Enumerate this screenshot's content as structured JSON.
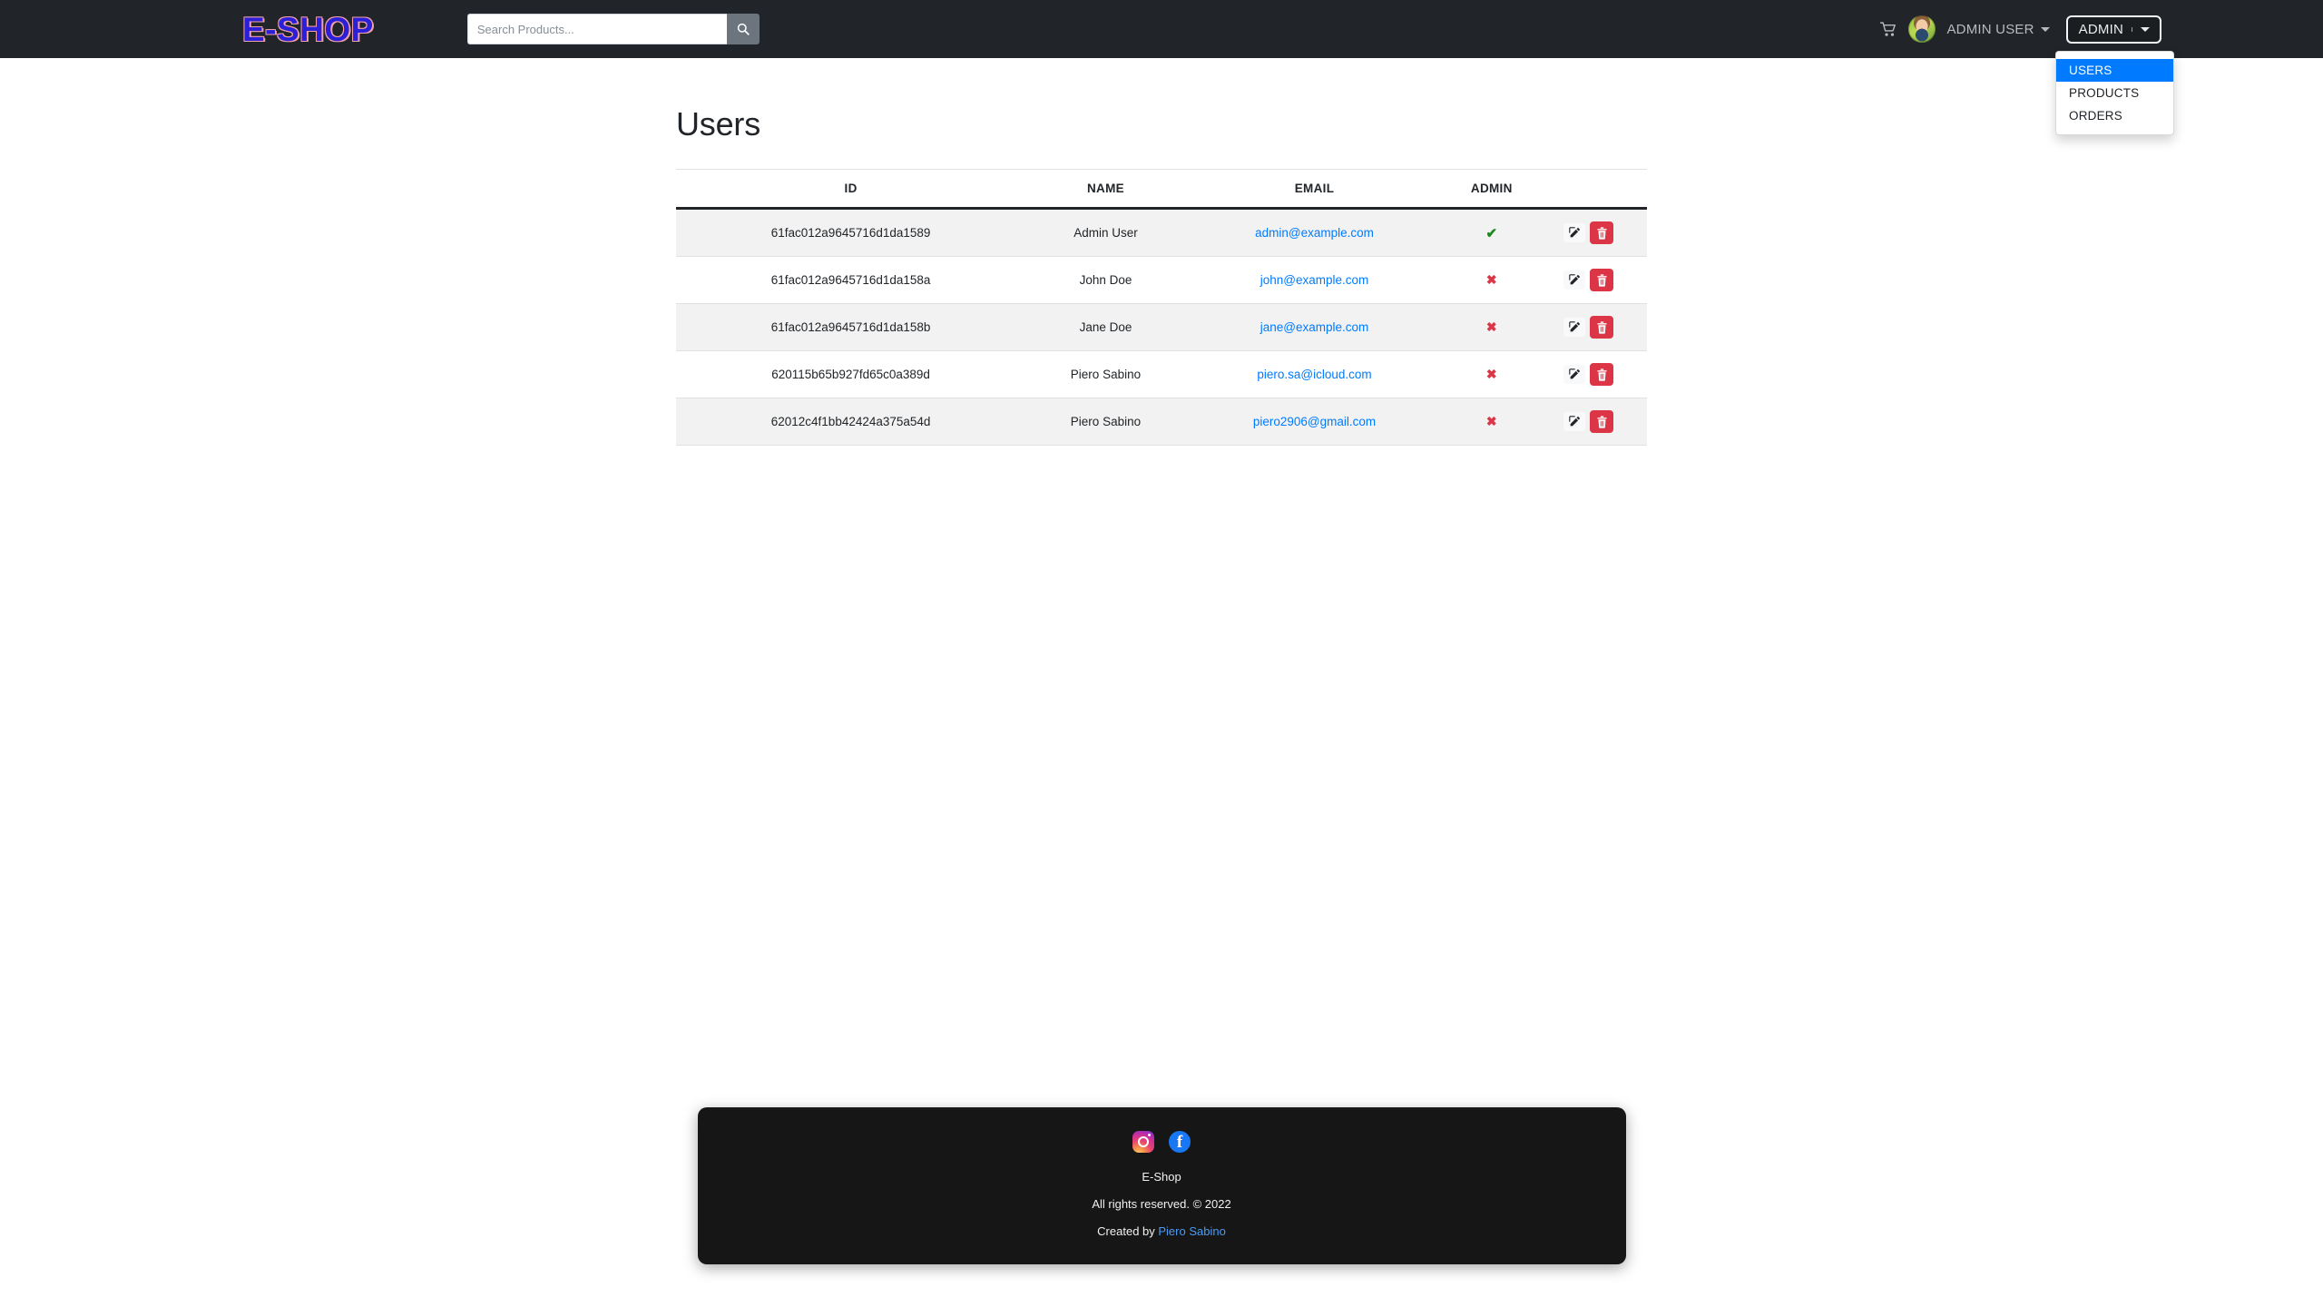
{
  "navbar": {
    "brand": "E-SHOP",
    "search": {
      "placeholder": "Search Products...",
      "value": "",
      "button_icon": "search-icon"
    },
    "cart_icon": "shopping-cart-icon",
    "avatar_icon": "user-avatar",
    "user_menu_label": "ADMIN USER",
    "admin_menu_label": "ADMIN",
    "caret_icon": "chevron-down-icon"
  },
  "dropdown": {
    "open": true,
    "items": [
      {
        "label": "USERS",
        "active": true
      },
      {
        "label": "PRODUCTS",
        "active": false
      },
      {
        "label": "ORDERS",
        "active": false
      }
    ],
    "active_color": "#007bff"
  },
  "main": {
    "title": "Users",
    "table": {
      "columns": [
        "ID",
        "NAME",
        "EMAIL",
        "ADMIN",
        ""
      ],
      "rows": [
        {
          "id": "61fac012a9645716d1da1589",
          "name": "Admin User",
          "email": "admin@example.com",
          "admin": true,
          "admin_mark": "✔",
          "edit_icon": "pencil-square-icon",
          "delete_icon": "trash-icon"
        },
        {
          "id": "61fac012a9645716d1da158a",
          "name": "John Doe",
          "email": "john@example.com",
          "admin": false,
          "admin_mark": "✖",
          "edit_icon": "pencil-square-icon",
          "delete_icon": "trash-icon"
        },
        {
          "id": "61fac012a9645716d1da158b",
          "name": "Jane Doe",
          "email": "jane@example.com",
          "admin": false,
          "admin_mark": "✖",
          "edit_icon": "pencil-square-icon",
          "delete_icon": "trash-icon"
        },
        {
          "id": "620115b65b927fd65c0a389d",
          "name": "Piero Sabino",
          "email": "piero.sa@icloud.com",
          "admin": false,
          "admin_mark": "✖",
          "edit_icon": "pencil-square-icon",
          "delete_icon": "trash-icon"
        },
        {
          "id": "62012c4f1bb42424a375a54d",
          "name": "Piero Sabino",
          "email": "piero2906@gmail.com",
          "admin": false,
          "admin_mark": "✖",
          "edit_icon": "pencil-square-icon",
          "delete_icon": "trash-icon"
        }
      ]
    }
  },
  "footer": {
    "instagram_icon": "instagram-icon",
    "facebook_icon": "facebook-icon",
    "facebook_glyph": "f",
    "brand": "E-Shop",
    "rights": "All rights reserved. © 2022",
    "created_prefix": "Created by ",
    "created_author": "Piero Sabino"
  },
  "colors": {
    "navbar_bg": "#212529",
    "footer_bg": "#161616",
    "link": "#007bff",
    "danger": "#dc3545",
    "success": "#1a8a1a",
    "brand_text": "#2b20d8",
    "brand_glow": "#f0a0a8"
  }
}
